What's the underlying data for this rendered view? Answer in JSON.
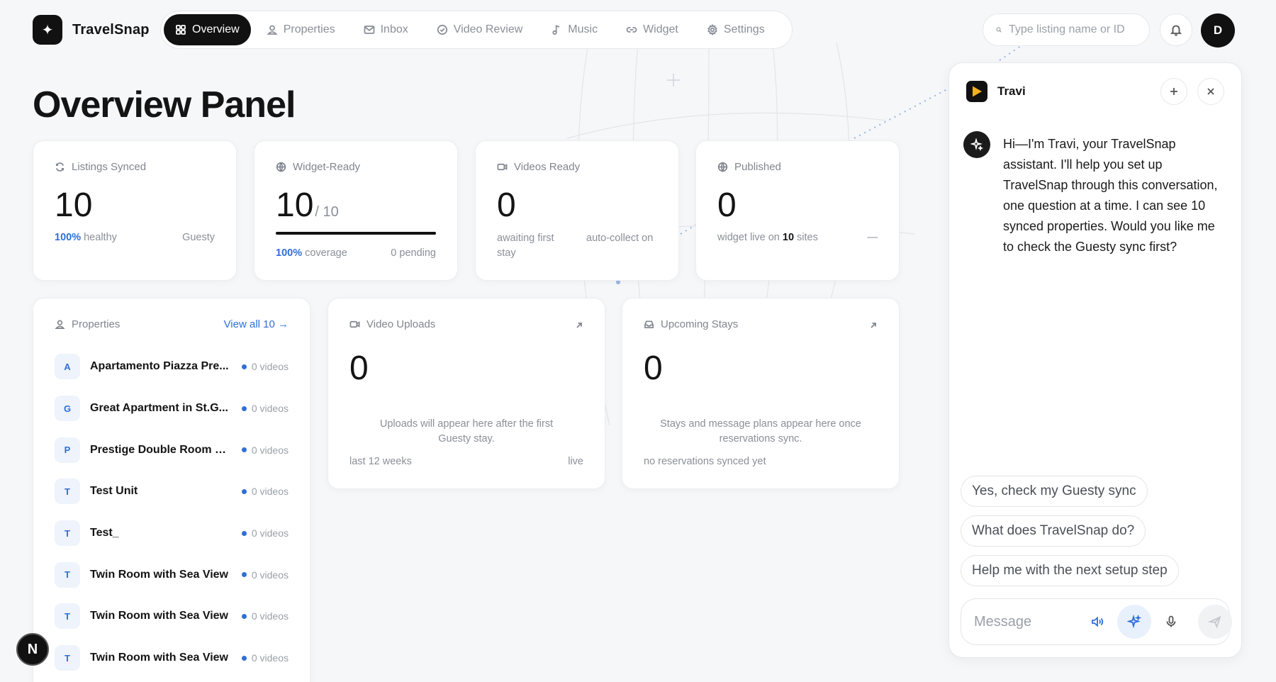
{
  "brand": {
    "name": "TravelSnap",
    "logo_icon": "sparkle-icon"
  },
  "nav": {
    "tabs": [
      {
        "label": "Overview",
        "icon": "grid-icon",
        "active": true
      },
      {
        "label": "Properties",
        "icon": "user-icon"
      },
      {
        "label": "Inbox",
        "icon": "mail-icon"
      },
      {
        "label": "Video Review",
        "icon": "check-circle-icon"
      },
      {
        "label": "Music",
        "icon": "music-note-icon"
      },
      {
        "label": "Widget",
        "icon": "link-icon"
      },
      {
        "label": "Settings",
        "icon": "gear-icon"
      }
    ]
  },
  "search": {
    "placeholder": "Type listing name or ID",
    "value": ""
  },
  "user": {
    "initial": "D"
  },
  "page": {
    "title": "Overview Panel"
  },
  "stats": {
    "listings": {
      "label": "Listings Synced",
      "value": "10",
      "pct": "100%",
      "pct_text": " healthy",
      "source": "Guesty"
    },
    "widget": {
      "label": "Widget-Ready",
      "value": "10",
      "total": "/ 10",
      "pct": "100%",
      "pct_text": " coverage",
      "pending": "0 pending",
      "progress": 1.0
    },
    "videos": {
      "label": "Videos Ready",
      "value": "0",
      "left": "awaiting first stay",
      "right": "auto-collect on"
    },
    "published": {
      "label": "Published",
      "value": "0",
      "text_a": "widget live on ",
      "sites": "10",
      "text_b": " sites",
      "dash": "—"
    }
  },
  "properties": {
    "label": "Properties",
    "view_all": "View all 10 →",
    "items": [
      {
        "initial": "A",
        "name": "Apartamento Piazza Pre...",
        "count": "0 videos"
      },
      {
        "initial": "G",
        "name": "Great Apartment in St.G...",
        "count": "0 videos"
      },
      {
        "initial": "P",
        "name": "Prestige Double Room w...",
        "count": "0 videos"
      },
      {
        "initial": "T",
        "name": "Test Unit",
        "count": "0 videos"
      },
      {
        "initial": "T",
        "name": "Test_",
        "count": "0 videos"
      },
      {
        "initial": "T",
        "name": "Twin Room with Sea View",
        "count": "0 videos"
      },
      {
        "initial": "T",
        "name": "Twin Room with Sea View",
        "count": "0 videos"
      },
      {
        "initial": "T",
        "name": "Twin Room with Sea View",
        "count": "0 videos"
      }
    ]
  },
  "uploads": {
    "label": "Video Uploads",
    "value": "0",
    "message": "Uploads will appear here after the first Guesty stay.",
    "foot_left": "last 12 weeks",
    "foot_right": "live"
  },
  "stays": {
    "label": "Upcoming Stays",
    "value": "0",
    "message": "Stays and message plans appear here once reservations sync.",
    "foot_left": "no reservations synced yet"
  },
  "chat": {
    "title": "Travi",
    "message": "Hi—I'm Travi, your TravelSnap assistant. I'll help you set up TravelSnap through this conversation, one question at a time. I can see 10 synced properties. Would you like me to check the Guesty sync first?",
    "suggestions": [
      "Yes, check my Guesty sync",
      "What does TravelSnap do?",
      "Help me with the next setup step"
    ],
    "composer_placeholder": "Message"
  },
  "corner_badge": "N",
  "colors": {
    "accent": "#2f6fd6",
    "dark": "#111111",
    "background": "#f6f7f9"
  }
}
